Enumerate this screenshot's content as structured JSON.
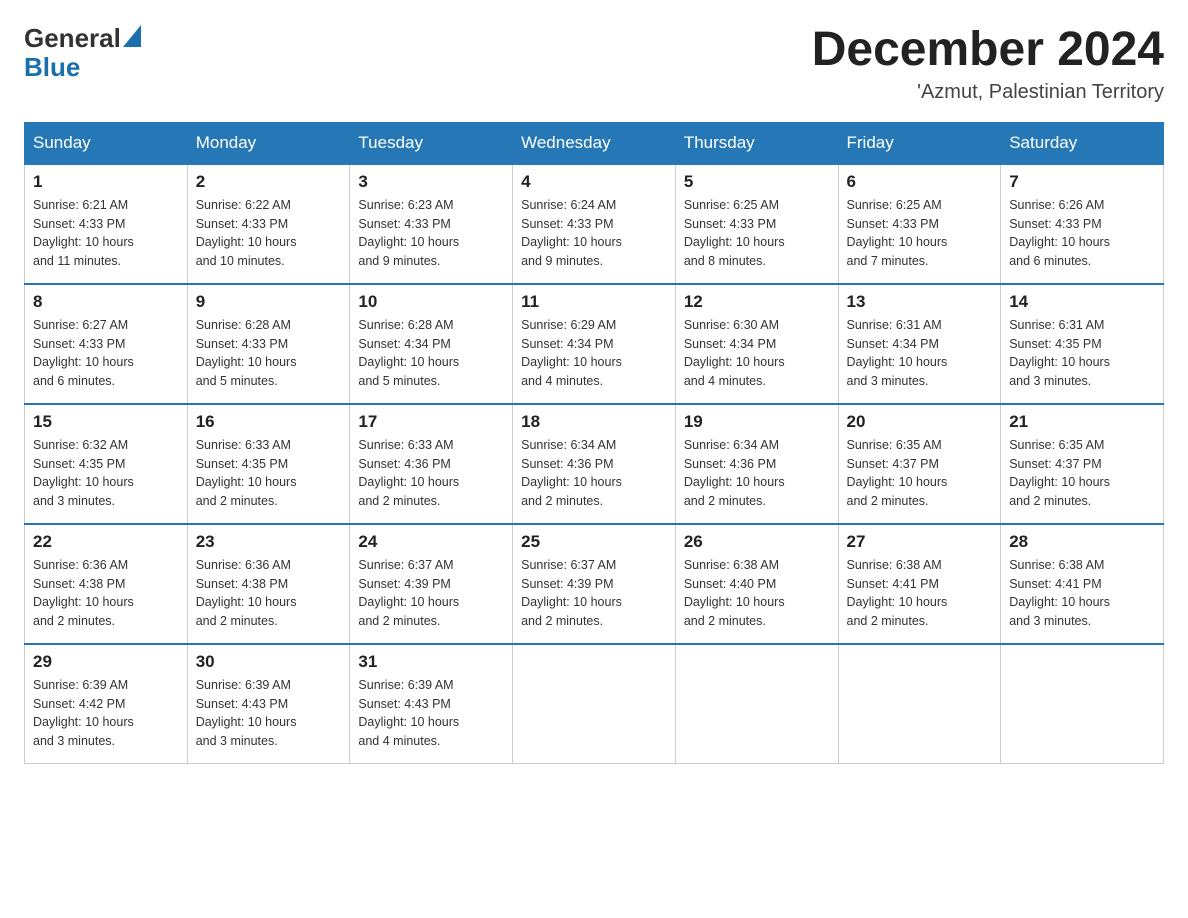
{
  "header": {
    "logo_general": "General",
    "logo_blue": "Blue",
    "month_title": "December 2024",
    "subtitle": "'Azmut, Palestinian Territory"
  },
  "days_of_week": [
    "Sunday",
    "Monday",
    "Tuesday",
    "Wednesday",
    "Thursday",
    "Friday",
    "Saturday"
  ],
  "weeks": [
    [
      {
        "day": "1",
        "sunrise": "6:21 AM",
        "sunset": "4:33 PM",
        "daylight": "10 hours and 11 minutes."
      },
      {
        "day": "2",
        "sunrise": "6:22 AM",
        "sunset": "4:33 PM",
        "daylight": "10 hours and 10 minutes."
      },
      {
        "day": "3",
        "sunrise": "6:23 AM",
        "sunset": "4:33 PM",
        "daylight": "10 hours and 9 minutes."
      },
      {
        "day": "4",
        "sunrise": "6:24 AM",
        "sunset": "4:33 PM",
        "daylight": "10 hours and 9 minutes."
      },
      {
        "day": "5",
        "sunrise": "6:25 AM",
        "sunset": "4:33 PM",
        "daylight": "10 hours and 8 minutes."
      },
      {
        "day": "6",
        "sunrise": "6:25 AM",
        "sunset": "4:33 PM",
        "daylight": "10 hours and 7 minutes."
      },
      {
        "day": "7",
        "sunrise": "6:26 AM",
        "sunset": "4:33 PM",
        "daylight": "10 hours and 6 minutes."
      }
    ],
    [
      {
        "day": "8",
        "sunrise": "6:27 AM",
        "sunset": "4:33 PM",
        "daylight": "10 hours and 6 minutes."
      },
      {
        "day": "9",
        "sunrise": "6:28 AM",
        "sunset": "4:33 PM",
        "daylight": "10 hours and 5 minutes."
      },
      {
        "day": "10",
        "sunrise": "6:28 AM",
        "sunset": "4:34 PM",
        "daylight": "10 hours and 5 minutes."
      },
      {
        "day": "11",
        "sunrise": "6:29 AM",
        "sunset": "4:34 PM",
        "daylight": "10 hours and 4 minutes."
      },
      {
        "day": "12",
        "sunrise": "6:30 AM",
        "sunset": "4:34 PM",
        "daylight": "10 hours and 4 minutes."
      },
      {
        "day": "13",
        "sunrise": "6:31 AM",
        "sunset": "4:34 PM",
        "daylight": "10 hours and 3 minutes."
      },
      {
        "day": "14",
        "sunrise": "6:31 AM",
        "sunset": "4:35 PM",
        "daylight": "10 hours and 3 minutes."
      }
    ],
    [
      {
        "day": "15",
        "sunrise": "6:32 AM",
        "sunset": "4:35 PM",
        "daylight": "10 hours and 3 minutes."
      },
      {
        "day": "16",
        "sunrise": "6:33 AM",
        "sunset": "4:35 PM",
        "daylight": "10 hours and 2 minutes."
      },
      {
        "day": "17",
        "sunrise": "6:33 AM",
        "sunset": "4:36 PM",
        "daylight": "10 hours and 2 minutes."
      },
      {
        "day": "18",
        "sunrise": "6:34 AM",
        "sunset": "4:36 PM",
        "daylight": "10 hours and 2 minutes."
      },
      {
        "day": "19",
        "sunrise": "6:34 AM",
        "sunset": "4:36 PM",
        "daylight": "10 hours and 2 minutes."
      },
      {
        "day": "20",
        "sunrise": "6:35 AM",
        "sunset": "4:37 PM",
        "daylight": "10 hours and 2 minutes."
      },
      {
        "day": "21",
        "sunrise": "6:35 AM",
        "sunset": "4:37 PM",
        "daylight": "10 hours and 2 minutes."
      }
    ],
    [
      {
        "day": "22",
        "sunrise": "6:36 AM",
        "sunset": "4:38 PM",
        "daylight": "10 hours and 2 minutes."
      },
      {
        "day": "23",
        "sunrise": "6:36 AM",
        "sunset": "4:38 PM",
        "daylight": "10 hours and 2 minutes."
      },
      {
        "day": "24",
        "sunrise": "6:37 AM",
        "sunset": "4:39 PM",
        "daylight": "10 hours and 2 minutes."
      },
      {
        "day": "25",
        "sunrise": "6:37 AM",
        "sunset": "4:39 PM",
        "daylight": "10 hours and 2 minutes."
      },
      {
        "day": "26",
        "sunrise": "6:38 AM",
        "sunset": "4:40 PM",
        "daylight": "10 hours and 2 minutes."
      },
      {
        "day": "27",
        "sunrise": "6:38 AM",
        "sunset": "4:41 PM",
        "daylight": "10 hours and 2 minutes."
      },
      {
        "day": "28",
        "sunrise": "6:38 AM",
        "sunset": "4:41 PM",
        "daylight": "10 hours and 3 minutes."
      }
    ],
    [
      {
        "day": "29",
        "sunrise": "6:39 AM",
        "sunset": "4:42 PM",
        "daylight": "10 hours and 3 minutes."
      },
      {
        "day": "30",
        "sunrise": "6:39 AM",
        "sunset": "4:43 PM",
        "daylight": "10 hours and 3 minutes."
      },
      {
        "day": "31",
        "sunrise": "6:39 AM",
        "sunset": "4:43 PM",
        "daylight": "10 hours and 4 minutes."
      },
      null,
      null,
      null,
      null
    ]
  ],
  "labels": {
    "sunrise": "Sunrise:",
    "sunset": "Sunset:",
    "daylight": "Daylight:"
  }
}
